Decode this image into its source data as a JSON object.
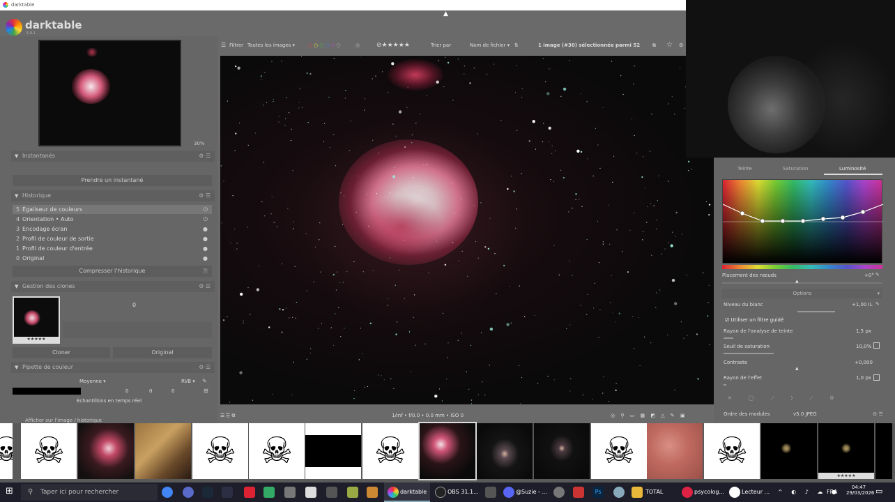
{
  "window": {
    "title": "darktable"
  },
  "app": {
    "name": "darktable",
    "version": "5.0.1"
  },
  "navigation": {
    "zoom": "30%"
  },
  "snapshots": {
    "header": "Instantanés",
    "take_button": "Prendre un instantané"
  },
  "history": {
    "header": "Historique",
    "items": [
      {
        "n": "5",
        "label": "Égaliseur de couleurs"
      },
      {
        "n": "4",
        "label": "Orientation • Auto"
      },
      {
        "n": "3",
        "label": "Encodage écran"
      },
      {
        "n": "2",
        "label": "Profil de couleur de sortie"
      },
      {
        "n": "1",
        "label": "Profil de couleur d'entrée"
      },
      {
        "n": "0",
        "label": "Original"
      }
    ],
    "compress_button": "Compresser l'historique"
  },
  "duplicates": {
    "header": "Gestion des clones",
    "count": "0",
    "clone_button": "Cloner",
    "original_button": "Original"
  },
  "color_picker": {
    "header": "Pipette de couleur",
    "mode": "Moyenne",
    "space": "RVB",
    "values": [
      "0",
      "0",
      "0"
    ],
    "samples": "Échantillons en temps réel",
    "next_header": "Afficher sur l'image / historique"
  },
  "topbar": {
    "filter_label": "Filtrer",
    "filter_value": "Toutes les images",
    "sort_label": "Trier par",
    "sort_value": "Nom de fichier",
    "selection": "1 image (#30) sélectionnée parmi 52"
  },
  "image_info": "1/inf • f/0.0 • 0.0 mm • ISO 0",
  "equalizer": {
    "tabs": [
      "Teinte",
      "Saturation",
      "Luminosité"
    ],
    "node_placement": "Placement des nœuds",
    "node_value": "+0°",
    "options_header": "Options",
    "white_level_label": "Niveau du blanc",
    "white_level_value": "+1,00 IL",
    "guided_filter": "Utiliser un filtre guidé",
    "radius_label": "Rayon de l'analyse de teinte",
    "radius_value": "1,5 px",
    "sat_threshold_label": "Seuil de saturation",
    "sat_threshold_value": "10,0%",
    "contrast_label": "Contraste",
    "contrast_value": "+0,000",
    "effect_radius_label": "Rayon de l'effet",
    "effect_radius_value": "1,0 px"
  },
  "module_order": {
    "label": "Ordre des modules",
    "value": "v5.0 JPEG"
  },
  "taskbar": {
    "search_placeholder": "Taper ici pour rechercher",
    "apps": [
      "darktable",
      "OBS 31.1...",
      "@Suzie - ...",
      "TOTAL",
      "psycolog...",
      "Lecteur ..."
    ],
    "lang": "FRA",
    "time": "04:47",
    "date": "29/03/2026"
  }
}
